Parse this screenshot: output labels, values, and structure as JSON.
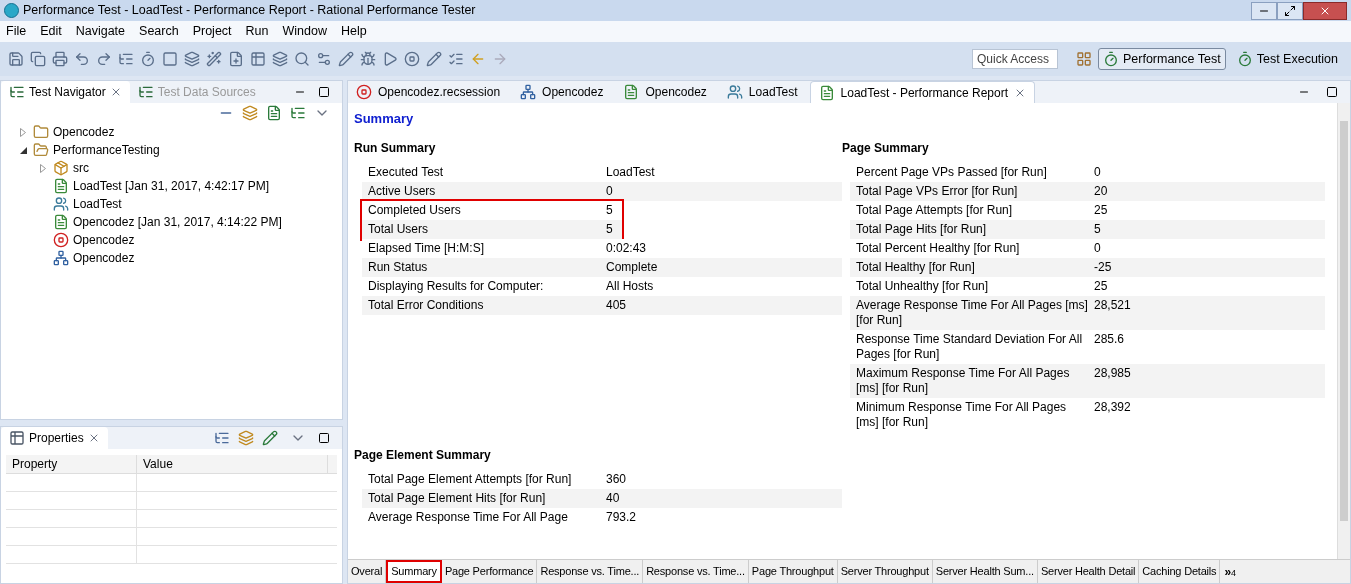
{
  "window": {
    "title": "Performance Test - LoadTest - Performance Report - Rational Performance Tester"
  },
  "menu": [
    "File",
    "Edit",
    "Navigate",
    "Search",
    "Project",
    "Run",
    "Window",
    "Help"
  ],
  "toolbar": {
    "quick_access": {
      "placeholder": "Quick Access"
    },
    "perspectives": [
      {
        "label": "Performance Test",
        "selected": true
      },
      {
        "label": "Test Execution",
        "selected": false
      }
    ]
  },
  "navigator": {
    "tabs": [
      {
        "label": "Test Navigator",
        "selected": true
      },
      {
        "label": "Test Data Sources",
        "selected": false
      }
    ],
    "tree": [
      {
        "label": "Opencodez",
        "kind": "project",
        "expanded": false
      },
      {
        "label": "PerformanceTesting",
        "kind": "project",
        "expanded": true,
        "children": [
          {
            "label": "src",
            "kind": "package",
            "expanded": false
          },
          {
            "label": "LoadTest [Jan 31, 2017, 4:42:17 PM]",
            "kind": "report"
          },
          {
            "label": "LoadTest",
            "kind": "schedule"
          },
          {
            "label": "Opencodez [Jan 31, 2017, 4:14:22 PM]",
            "kind": "report"
          },
          {
            "label": "Opencodez",
            "kind": "recording"
          },
          {
            "label": "Opencodez",
            "kind": "test"
          }
        ]
      }
    ]
  },
  "properties": {
    "title": "Properties",
    "columns": [
      "Property",
      "Value"
    ]
  },
  "editor_tabs": [
    {
      "label": "Opencodez.recsession",
      "kind": "recording",
      "selected": false
    },
    {
      "label": "Opencodez",
      "kind": "test",
      "selected": false
    },
    {
      "label": "Opencodez",
      "kind": "report",
      "selected": false
    },
    {
      "label": "LoadTest",
      "kind": "schedule",
      "selected": false
    },
    {
      "label": "LoadTest - Performance Report",
      "kind": "report",
      "selected": true
    }
  ],
  "report": {
    "title": "Summary",
    "run_summary": {
      "title": "Run Summary",
      "rows": [
        {
          "label": "Executed Test",
          "value": "LoadTest",
          "highlighted": false
        },
        {
          "label": "Active Users",
          "value": "0",
          "highlighted": false
        },
        {
          "label": "Completed Users",
          "value": "5",
          "highlighted": true
        },
        {
          "label": "Total Users",
          "value": "5",
          "highlighted": true
        },
        {
          "label": "Elapsed Time [H:M:S]",
          "value": "0:02:43",
          "highlighted": false
        },
        {
          "label": "Run Status",
          "value": "Complete",
          "highlighted": false
        },
        {
          "label": "Displaying Results for Computer:",
          "value": "All Hosts",
          "highlighted": false
        },
        {
          "label": "Total Error Conditions",
          "value": "405",
          "highlighted": false
        }
      ]
    },
    "page_summary": {
      "title": "Page Summary",
      "rows": [
        {
          "label": "Percent Page VPs Passed [for Run]",
          "value": "0",
          "highlighted": false
        },
        {
          "label": "Total Page VPs Error [for Run]",
          "value": "20",
          "highlighted": false
        },
        {
          "label": "Total Page Attempts [for Run]",
          "value": "25",
          "highlighted": false
        },
        {
          "label": "Total Page Hits [for Run]",
          "value": "5",
          "highlighted": false
        },
        {
          "label": "Total Percent Healthy [for Run]",
          "value": "0",
          "highlighted": false
        },
        {
          "label": "Total Healthy [for Run]",
          "value": "-25",
          "highlighted": false
        },
        {
          "label": "Total Unhealthy [for Run]",
          "value": "25",
          "highlighted": false
        },
        {
          "label": "Average Response Time For All Pages [ms] [for Run]",
          "value": "28,521",
          "highlighted": false
        },
        {
          "label": "Response Time Standard Deviation For All Pages [for Run]",
          "value": "285.6",
          "highlighted": false
        },
        {
          "label": "Maximum Response Time For All Pages [ms] [for Run]",
          "value": "28,985",
          "highlighted": false
        },
        {
          "label": "Minimum Response Time For All Pages [ms] [for Run]",
          "value": "28,392",
          "highlighted": false
        }
      ]
    },
    "page_element_summary": {
      "title": "Page Element Summary",
      "rows": [
        {
          "label": "Total Page Element Attempts [for Run]",
          "value": "360",
          "highlighted": false
        },
        {
          "label": "Total Page Element Hits [for Run]",
          "value": "40",
          "highlighted": false
        },
        {
          "label": "Average Response Time For All Page",
          "value": "793.2",
          "highlighted": false
        }
      ]
    },
    "bottom_tabs": [
      {
        "label": "Overal",
        "selected": false,
        "highlighted": false
      },
      {
        "label": "Summary",
        "selected": true,
        "highlighted": true
      },
      {
        "label": "Page Performance",
        "selected": false,
        "highlighted": false
      },
      {
        "label": "Response vs. Time...",
        "selected": false,
        "highlighted": false
      },
      {
        "label": "Response vs. Time...",
        "selected": false,
        "highlighted": false
      },
      {
        "label": "Page Throughput",
        "selected": false,
        "highlighted": false
      },
      {
        "label": "Server Throughput",
        "selected": false,
        "highlighted": false
      },
      {
        "label": "Server Health Sum...",
        "selected": false,
        "highlighted": false
      },
      {
        "label": "Server Health Detail",
        "selected": false,
        "highlighted": false
      },
      {
        "label": "Caching Details",
        "selected": false,
        "highlighted": false
      }
    ],
    "overflow": {
      "arrows": "»",
      "count": "4"
    }
  }
}
